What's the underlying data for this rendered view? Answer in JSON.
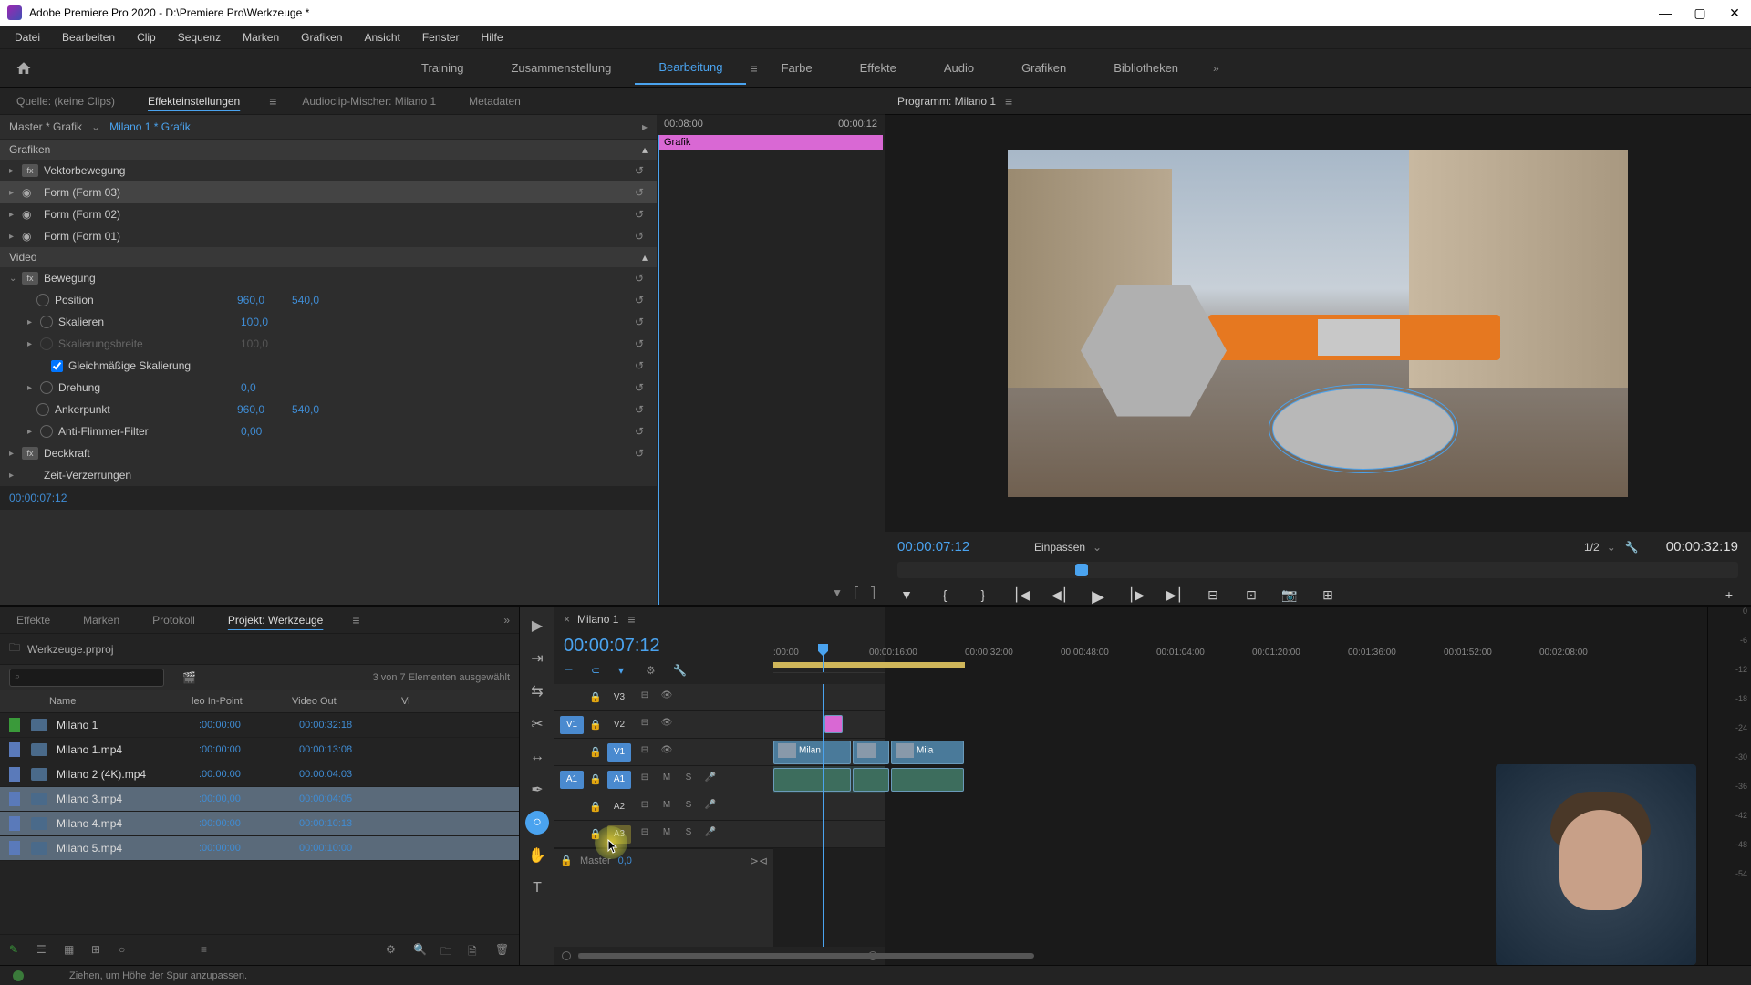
{
  "titlebar": {
    "text": "Adobe Premiere Pro 2020 - D:\\Premiere Pro\\Werkzeuge *"
  },
  "menu": [
    "Datei",
    "Bearbeiten",
    "Clip",
    "Sequenz",
    "Marken",
    "Grafiken",
    "Ansicht",
    "Fenster",
    "Hilfe"
  ],
  "workspaces": {
    "items": [
      "Training",
      "Zusammenstellung",
      "Bearbeitung",
      "Farbe",
      "Effekte",
      "Audio",
      "Grafiken",
      "Bibliotheken"
    ],
    "active": "Bearbeitung"
  },
  "source_tabs": {
    "quelle": "Quelle: (keine Clips)",
    "effekteinstellungen": "Effekteinstellungen",
    "audiomixer": "Audioclip-Mischer: Milano 1",
    "metadaten": "Metadaten"
  },
  "effect_controls": {
    "master": "Master * Grafik",
    "clip": "Milano 1 * Grafik",
    "time_left": "00:08:00",
    "time_right": "00:00:12",
    "grafik_bar": "Grafik",
    "sections": {
      "grafiken": "Grafiken",
      "video": "Video"
    },
    "rows": {
      "vektorbewegung": "Vektorbewegung",
      "form03": "Form (Form 03)",
      "form02": "Form (Form 02)",
      "form01": "Form (Form 01)",
      "bewegung": "Bewegung",
      "position": "Position",
      "position_x": "960,0",
      "position_y": "540,0",
      "skalieren": "Skalieren",
      "skalieren_val": "100,0",
      "skalierungsbreite": "Skalierungsbreite",
      "skalierungsbreite_val": "100,0",
      "gleichmaessig": "Gleichmäßige Skalierung",
      "drehung": "Drehung",
      "drehung_val": "0,0",
      "ankerpunkt": "Ankerpunkt",
      "anker_x": "960,0",
      "anker_y": "540,0",
      "antiflimmer": "Anti-Flimmer-Filter",
      "antiflimmer_val": "0,00",
      "deckkraft": "Deckkraft",
      "zeitverzerrungen": "Zeit-Verzerrungen"
    },
    "timecode": "00:00:07:12"
  },
  "program": {
    "title": "Programm: Milano 1",
    "timecode": "00:00:07:12",
    "fit": "Einpassen",
    "zoom": "1/2",
    "duration": "00:00:32:19"
  },
  "project_tabs": {
    "effekte": "Effekte",
    "marken": "Marken",
    "protokoll": "Protokoll",
    "projekt": "Projekt: Werkzeuge"
  },
  "project": {
    "filename": "Werkzeuge.prproj",
    "selection_text": "3 von 7 Elementen ausgewählt",
    "columns": {
      "name": "Name",
      "inpoint": "leo In-Point",
      "outpoint": "Video Out",
      "vi": "Vi"
    },
    "items": [
      {
        "color": "#3a9a3a",
        "name": "Milano 1",
        "in": ":00:00:00",
        "out": "00:00:32:18",
        "selected": false
      },
      {
        "color": "#5a7aba",
        "name": "Milano 1.mp4",
        "in": ":00:00:00",
        "out": "00:00:13:08",
        "selected": false
      },
      {
        "color": "#5a7aba",
        "name": "Milano 2 (4K).mp4",
        "in": ":00:00:00",
        "out": "00:00:04:03",
        "selected": false
      },
      {
        "color": "#5a7aba",
        "name": "Milano 3.mp4",
        "in": ":00:00,00",
        "out": "00:00:04:05",
        "selected": true
      },
      {
        "color": "#5a7aba",
        "name": "Milano 4.mp4",
        "in": ":00:00:00",
        "out": "00:00:10:13",
        "selected": true
      },
      {
        "color": "#5a7aba",
        "name": "Milano 5.mp4",
        "in": ":00:00:00",
        "out": "00:00:10:00",
        "selected": true
      }
    ]
  },
  "timeline": {
    "sequence": "Milano 1",
    "timecode": "00:00:07:12",
    "ticks": [
      ":00:00",
      "00:00:16:00",
      "00:00:32:00",
      "00:00:48:00",
      "00:01:04:00",
      "00:01:20:00",
      "00:01:36:00",
      "00:01:52:00",
      "00:02:08:00"
    ],
    "video_tracks": [
      {
        "src": "",
        "name": "V3",
        "targeted": false
      },
      {
        "src": "V1",
        "name": "V2",
        "targeted": false
      },
      {
        "src": "",
        "name": "V1",
        "targeted": true
      }
    ],
    "audio_tracks": [
      {
        "src": "A1",
        "name": "A1",
        "targeted": true
      },
      {
        "src": "",
        "name": "A2",
        "targeted": false
      },
      {
        "src": "",
        "name": "A3",
        "targeted": false
      }
    ],
    "clips": {
      "v2_grafik": "",
      "v1_clip1": "Milan",
      "v1_clip2": "Mila"
    },
    "master": "Master",
    "master_val": "0,0"
  },
  "statusbar": "Ziehen, um Höhe der Spur anzupassen.",
  "audio_meter_labels": [
    "0",
    "-6",
    "-12",
    "-18",
    "-24",
    "-30",
    "-36",
    "-42",
    "-48",
    "-54"
  ]
}
